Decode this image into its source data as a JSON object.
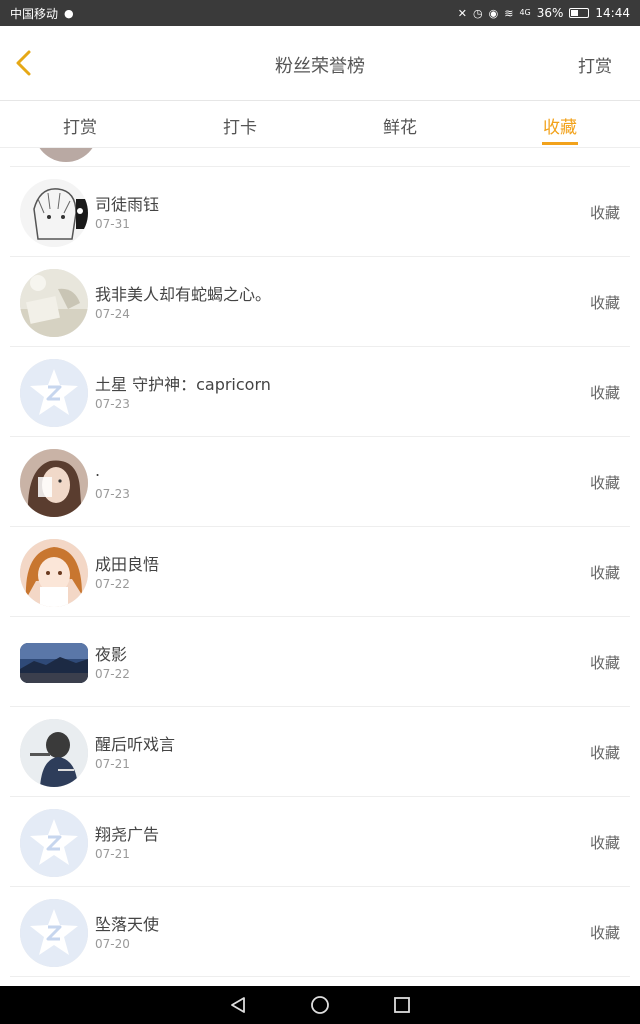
{
  "status_bar": {
    "carrier": "中国移动",
    "battery": "36%",
    "time": "14:44",
    "signal": "4G"
  },
  "header": {
    "title": "粉丝荣誉榜",
    "action_label": "打赏"
  },
  "tabs": [
    {
      "label": "打赏",
      "active": false
    },
    {
      "label": "打卡",
      "active": false
    },
    {
      "label": "鲜花",
      "active": false
    },
    {
      "label": "收藏",
      "active": true
    }
  ],
  "rows": [
    {
      "name": "司徒雨钰",
      "date": "07-31",
      "action": "收藏",
      "avatar": "sketch-avatar"
    },
    {
      "name": "我非美人却有蛇蝎之心。",
      "date": "07-24",
      "action": "收藏",
      "avatar": "photo-avatar"
    },
    {
      "name": "土星 守护神：capricorn",
      "date": "07-23",
      "action": "收藏",
      "avatar": "default-qq-avatar"
    },
    {
      "name": ".",
      "date": "07-23",
      "action": "收藏",
      "avatar": "portrait-avatar"
    },
    {
      "name": "成田良悟",
      "date": "07-22",
      "action": "收藏",
      "avatar": "anime-avatar"
    },
    {
      "name": "夜影",
      "date": "07-22",
      "action": "收藏",
      "avatar": "landscape-avatar"
    },
    {
      "name": "醒后听戏言",
      "date": "07-21",
      "action": "收藏",
      "avatar": "back-portrait-avatar"
    },
    {
      "name": "翔尧广告",
      "date": "07-21",
      "action": "收藏",
      "avatar": "default-qq-avatar"
    },
    {
      "name": "坠落天使",
      "date": "07-20",
      "action": "收藏",
      "avatar": "default-qq-avatar"
    }
  ],
  "colors": {
    "accent": "#f2a21b",
    "status_bar": "#3a3a3a",
    "nav_bar": "#000000"
  }
}
